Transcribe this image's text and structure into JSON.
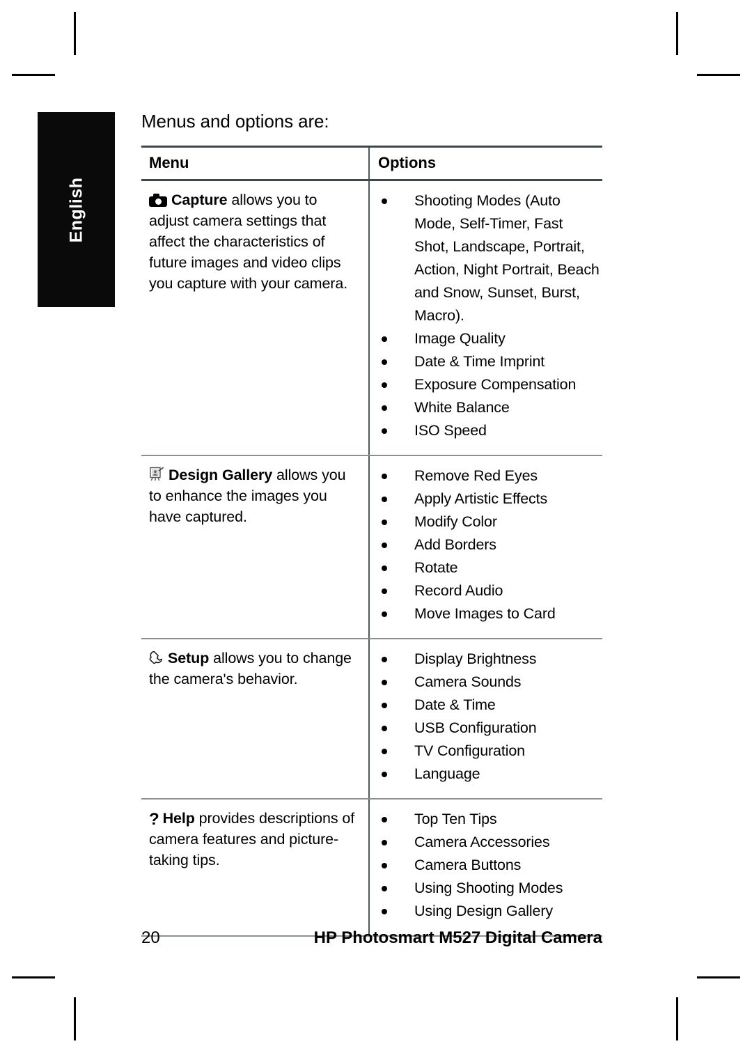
{
  "page": {
    "language_tab": "English",
    "intro": "Menus and options are:",
    "footer": {
      "page_number": "20",
      "doc_title": "HP Photosmart M527 Digital Camera"
    }
  },
  "table": {
    "headers": {
      "menu": "Menu",
      "options": "Options"
    },
    "rows": [
      {
        "icon": "camera-icon",
        "name": "Capture",
        "description": " allows you to adjust camera settings that affect the characteristics of future images and video clips you capture with your camera.",
        "options": [
          "Shooting Modes (Auto Mode, Self-Timer, Fast Shot, Landscape, Portrait, Action, Night Portrait, Beach and Snow, Sunset, Burst, Macro).",
          "Image Quality",
          "Date & Time Imprint",
          "Exposure Compensation",
          "White Balance",
          "ISO Speed"
        ]
      },
      {
        "icon": "design-gallery-icon",
        "name": "Design Gallery",
        "description": " allows you to enhance the images you have captured.",
        "options": [
          "Remove Red Eyes",
          "Apply Artistic Effects",
          "Modify Color",
          "Add Borders",
          "Rotate",
          "Record Audio",
          "Move Images to Card"
        ]
      },
      {
        "icon": "wrench-icon",
        "name": "Setup",
        "description": " allows you to change the camera's behavior.",
        "options": [
          "Display Brightness",
          "Camera Sounds",
          "Date & Time",
          "USB Configuration",
          "TV Configuration",
          "Language"
        ]
      },
      {
        "icon": "question-mark-icon",
        "name": "Help",
        "description": " provides descriptions of camera features and picture-taking tips.",
        "options": [
          "Top Ten Tips",
          "Camera Accessories",
          "Camera Buttons",
          "Using Shooting Modes",
          "Using Design Gallery"
        ]
      }
    ]
  },
  "colors": {
    "tab_background": "#0a0a0a",
    "tab_text": "#ffffff",
    "rule_strong": "#3a4a4a",
    "rule_light": "#8a9090",
    "text": "#000000"
  }
}
